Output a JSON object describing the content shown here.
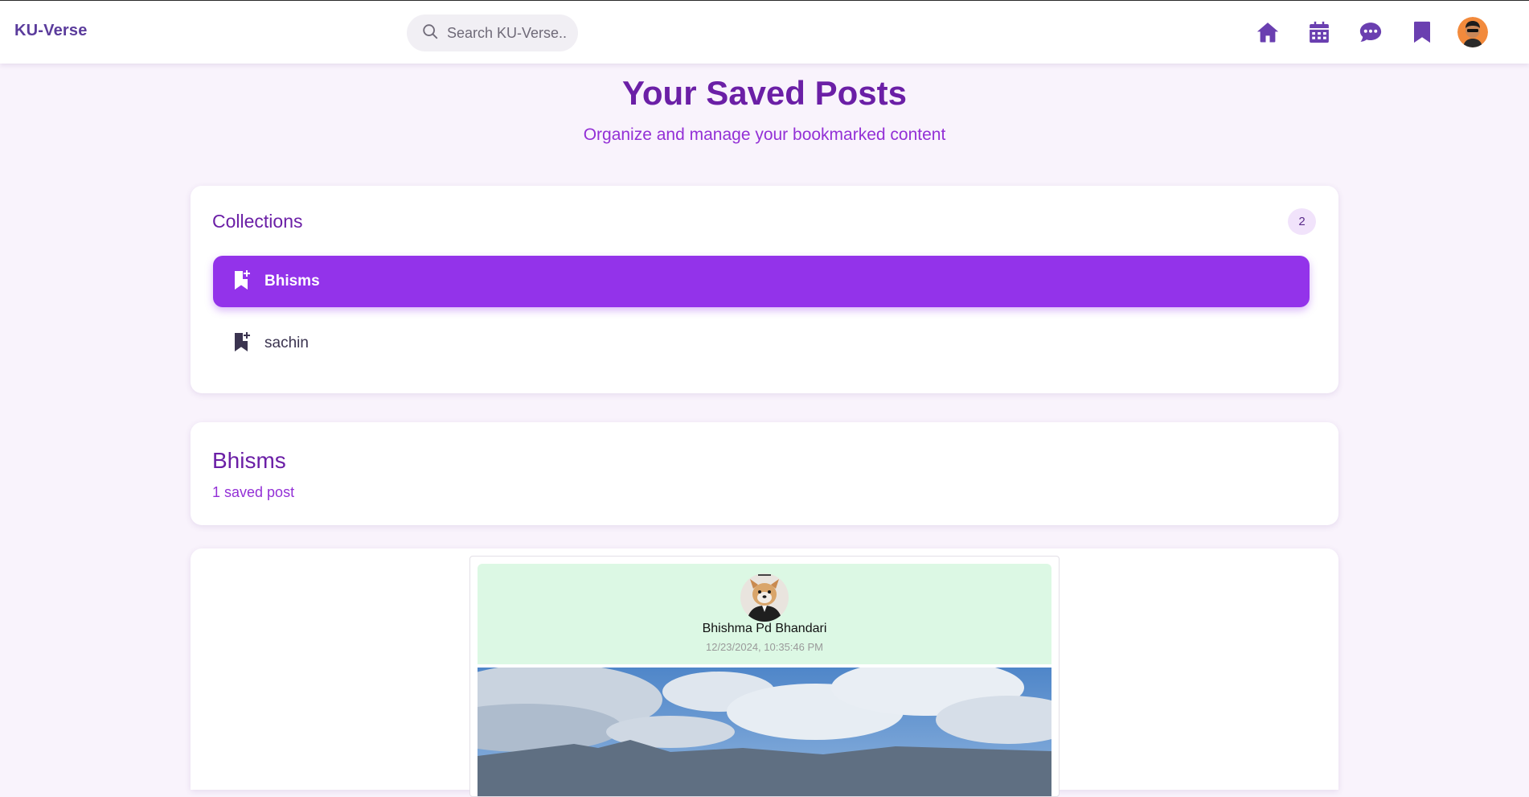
{
  "navbar": {
    "brand": "KU-Verse",
    "search_placeholder": "Search KU-Verse...",
    "icons": [
      "home-icon",
      "calendar-icon",
      "chat-icon",
      "bookmark-icon",
      "user-avatar"
    ]
  },
  "header": {
    "title": "Your Saved Posts",
    "subtitle": "Organize and manage your bookmarked content"
  },
  "collections": {
    "title": "Collections",
    "count": "2",
    "items": [
      {
        "label": "Bhisms",
        "active": true
      },
      {
        "label": "sachin",
        "active": false
      }
    ]
  },
  "selected_collection": {
    "title": "Bhisms",
    "count_text": "1 saved post"
  },
  "posts": [
    {
      "author": "Bhishma Pd Bhandari",
      "date": "12/23/2024, 10:35:46 PM"
    }
  ],
  "colors": {
    "accent": "#9333ea",
    "title": "#6b1fa6",
    "subtitle": "#9330d6",
    "nav_icon": "#6a3fb0",
    "post_header_bg": "#dcf8e4",
    "page_bg": "#f9f3fc"
  }
}
